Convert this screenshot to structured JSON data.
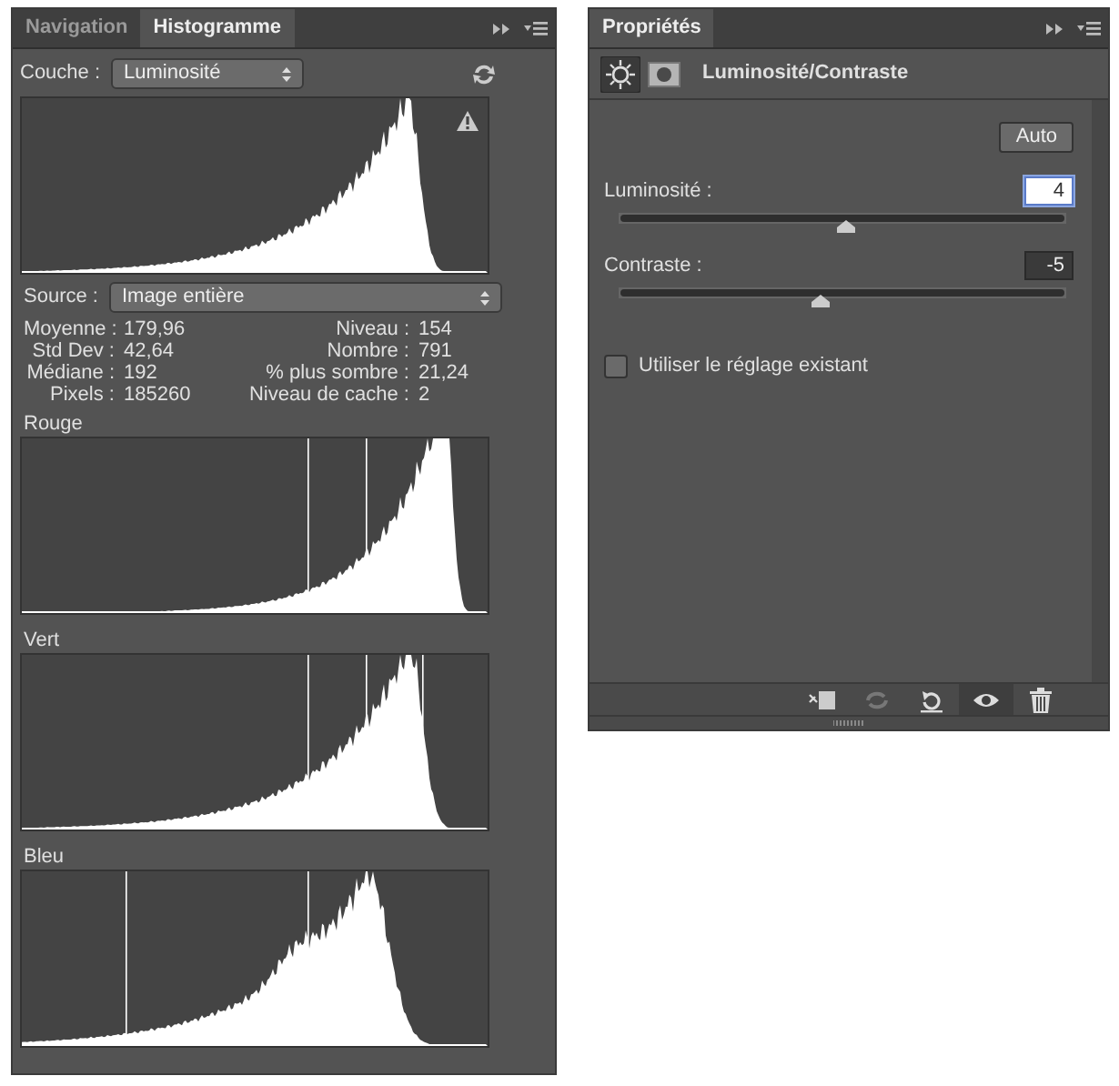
{
  "histogram_panel": {
    "tabs": [
      {
        "label": "Navigation",
        "selected": false
      },
      {
        "label": "Histogramme",
        "selected": true
      }
    ],
    "channel": {
      "label": "Couche :",
      "value": "Luminosité"
    },
    "source": {
      "label": "Source :",
      "value": "Image entière"
    },
    "stats": [
      {
        "label": "Moyenne :",
        "value": "179,96",
        "label_2": "Niveau :",
        "value_2": "154"
      },
      {
        "label": "Std Dev :",
        "value": "42,64",
        "label_2": "Nombre :",
        "value_2": "791"
      },
      {
        "label": "Médiane :",
        "value": "192",
        "label_2": "% plus sombre :",
        "value_2": "21,24"
      },
      {
        "label": "Pixels :",
        "value": "185260",
        "label_2": "Niveau de cache :",
        "value_2": "2"
      }
    ],
    "channels": [
      {
        "label": "Rouge"
      },
      {
        "label": "Vert"
      },
      {
        "label": "Bleu"
      }
    ]
  },
  "properties_panel": {
    "tabs": [
      {
        "label": "Propriétés",
        "selected": true
      }
    ],
    "title": "Luminosité/Contraste",
    "auto_button": "Auto",
    "sliders": [
      {
        "label": "Luminosité :",
        "value": "4",
        "focused": true,
        "level": 0.51
      },
      {
        "label": "Contraste :",
        "value": "-5",
        "focused": false,
        "level": 0.45
      }
    ],
    "checkbox": {
      "label": "Utiliser le réglage existant",
      "checked": false
    }
  }
}
